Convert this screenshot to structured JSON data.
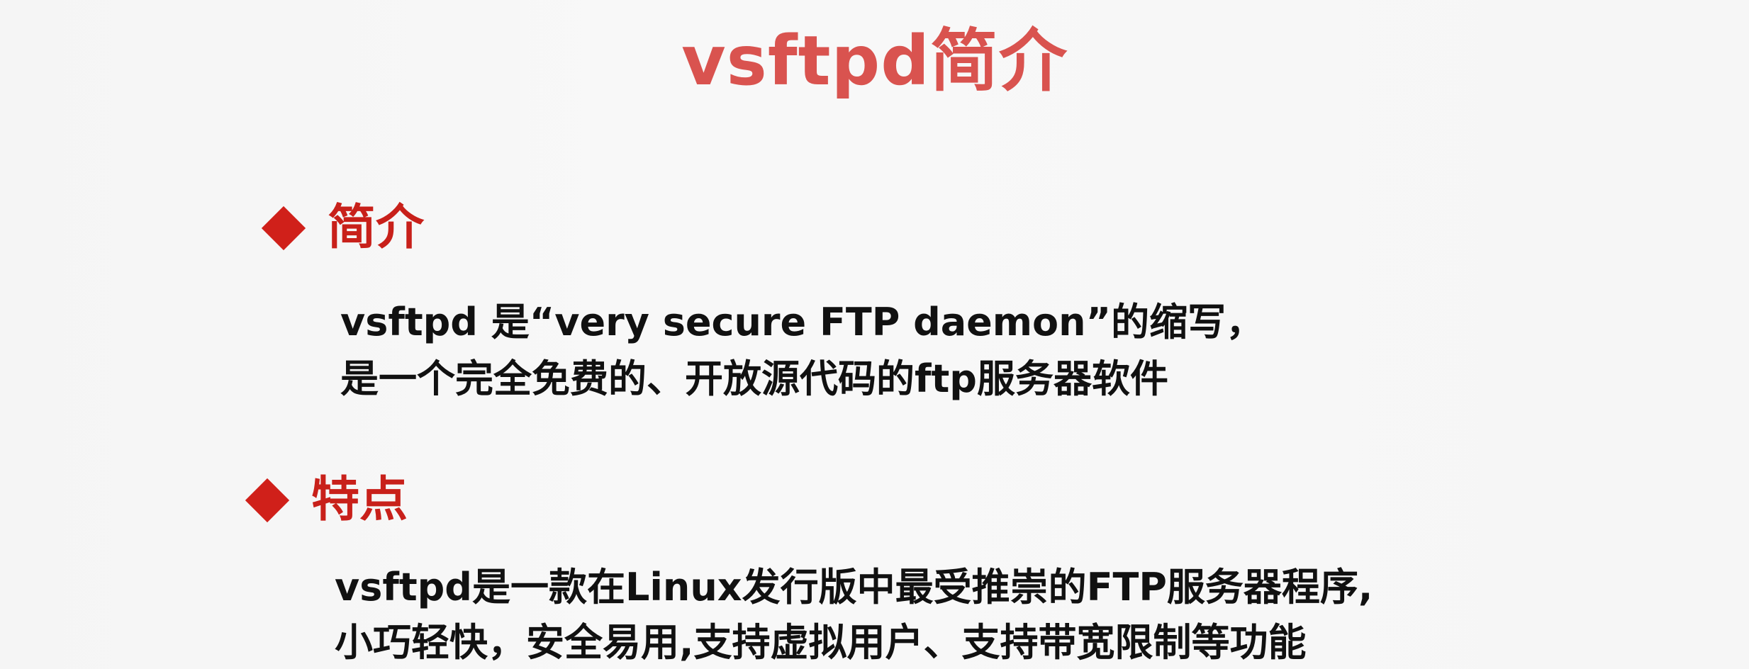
{
  "title": "vsftpd简介",
  "sections": [
    {
      "heading": "简介",
      "lines": [
        "vsftpd 是“very secure FTP daemon”的缩写，",
        "是一个完全免费的、开放源代码的ftp服务器软件"
      ]
    },
    {
      "heading": "特点",
      "lines": [
        "vsftpd是一款在Linux发行版中最受推崇的FTP服务器程序,",
        "小巧轻快，安全易用,支持虚拟用户、支持带宽限制等功能"
      ]
    }
  ],
  "colors": {
    "title": "#d9534f",
    "accent": "#c8201a",
    "text": "#111111",
    "background": "#f5f5f5"
  }
}
